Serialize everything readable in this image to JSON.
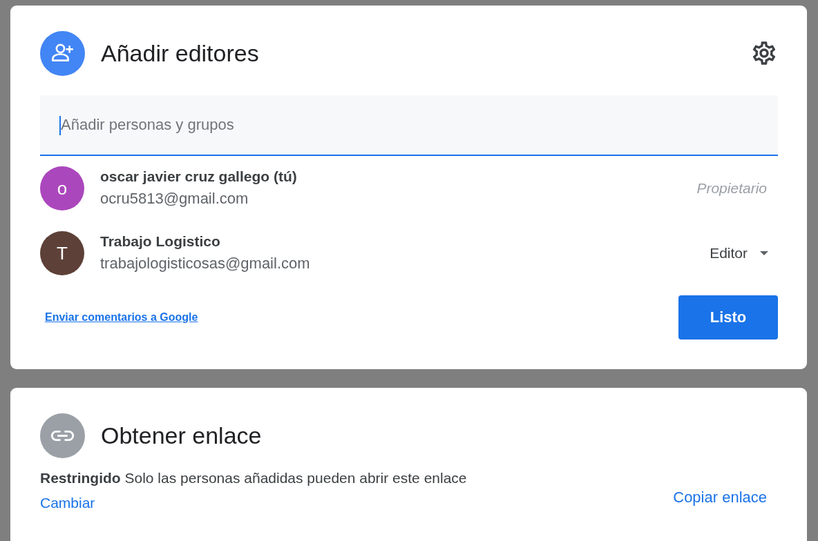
{
  "share_dialog": {
    "title": "Añadir editores",
    "search": {
      "placeholder": "Añadir personas y grupos",
      "focused": true
    },
    "people": [
      {
        "initial": "o",
        "color": "#ab47bc",
        "name": "oscar javier cruz gallego (tú)",
        "email": "ocru5813@gmail.com",
        "kind": "owner",
        "role": "Propietario"
      },
      {
        "initial": "T",
        "color": "#5d4037",
        "name": "Trabajo Logistico",
        "email": "trabajologisticosas@gmail.com",
        "kind": "editor",
        "role": "Editor"
      }
    ],
    "feedback_link": "Enviar comentarios a Google",
    "done_button": "Listo"
  },
  "link_dialog": {
    "title": "Obtener enlace",
    "access": "**Restringido** Solo las personas añadidas pueden abrir este enlace",
    "change_link": "Cambiar",
    "copy_link": "Copiar enlace"
  }
}
